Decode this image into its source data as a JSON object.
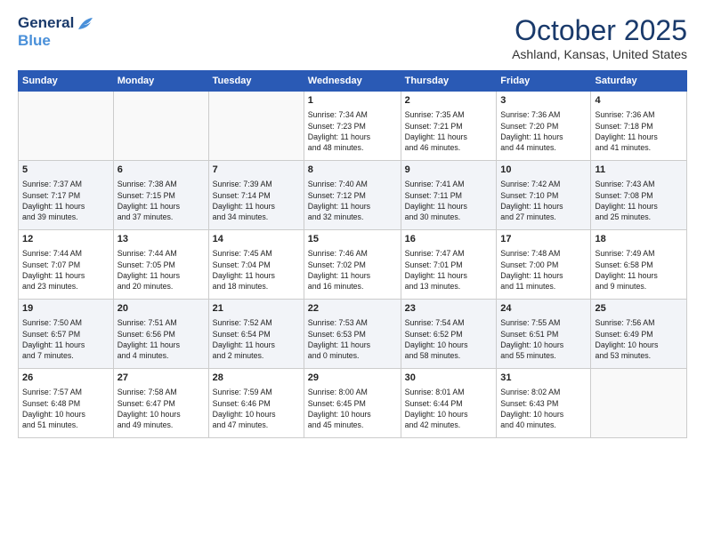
{
  "header": {
    "logo_line1": "General",
    "logo_line2": "Blue",
    "month": "October 2025",
    "location": "Ashland, Kansas, United States"
  },
  "days_of_week": [
    "Sunday",
    "Monday",
    "Tuesday",
    "Wednesday",
    "Thursday",
    "Friday",
    "Saturday"
  ],
  "weeks": [
    [
      {
        "day": "",
        "content": ""
      },
      {
        "day": "",
        "content": ""
      },
      {
        "day": "",
        "content": ""
      },
      {
        "day": "1",
        "content": "Sunrise: 7:34 AM\nSunset: 7:23 PM\nDaylight: 11 hours\nand 48 minutes."
      },
      {
        "day": "2",
        "content": "Sunrise: 7:35 AM\nSunset: 7:21 PM\nDaylight: 11 hours\nand 46 minutes."
      },
      {
        "day": "3",
        "content": "Sunrise: 7:36 AM\nSunset: 7:20 PM\nDaylight: 11 hours\nand 44 minutes."
      },
      {
        "day": "4",
        "content": "Sunrise: 7:36 AM\nSunset: 7:18 PM\nDaylight: 11 hours\nand 41 minutes."
      }
    ],
    [
      {
        "day": "5",
        "content": "Sunrise: 7:37 AM\nSunset: 7:17 PM\nDaylight: 11 hours\nand 39 minutes."
      },
      {
        "day": "6",
        "content": "Sunrise: 7:38 AM\nSunset: 7:15 PM\nDaylight: 11 hours\nand 37 minutes."
      },
      {
        "day": "7",
        "content": "Sunrise: 7:39 AM\nSunset: 7:14 PM\nDaylight: 11 hours\nand 34 minutes."
      },
      {
        "day": "8",
        "content": "Sunrise: 7:40 AM\nSunset: 7:12 PM\nDaylight: 11 hours\nand 32 minutes."
      },
      {
        "day": "9",
        "content": "Sunrise: 7:41 AM\nSunset: 7:11 PM\nDaylight: 11 hours\nand 30 minutes."
      },
      {
        "day": "10",
        "content": "Sunrise: 7:42 AM\nSunset: 7:10 PM\nDaylight: 11 hours\nand 27 minutes."
      },
      {
        "day": "11",
        "content": "Sunrise: 7:43 AM\nSunset: 7:08 PM\nDaylight: 11 hours\nand 25 minutes."
      }
    ],
    [
      {
        "day": "12",
        "content": "Sunrise: 7:44 AM\nSunset: 7:07 PM\nDaylight: 11 hours\nand 23 minutes."
      },
      {
        "day": "13",
        "content": "Sunrise: 7:44 AM\nSunset: 7:05 PM\nDaylight: 11 hours\nand 20 minutes."
      },
      {
        "day": "14",
        "content": "Sunrise: 7:45 AM\nSunset: 7:04 PM\nDaylight: 11 hours\nand 18 minutes."
      },
      {
        "day": "15",
        "content": "Sunrise: 7:46 AM\nSunset: 7:02 PM\nDaylight: 11 hours\nand 16 minutes."
      },
      {
        "day": "16",
        "content": "Sunrise: 7:47 AM\nSunset: 7:01 PM\nDaylight: 11 hours\nand 13 minutes."
      },
      {
        "day": "17",
        "content": "Sunrise: 7:48 AM\nSunset: 7:00 PM\nDaylight: 11 hours\nand 11 minutes."
      },
      {
        "day": "18",
        "content": "Sunrise: 7:49 AM\nSunset: 6:58 PM\nDaylight: 11 hours\nand 9 minutes."
      }
    ],
    [
      {
        "day": "19",
        "content": "Sunrise: 7:50 AM\nSunset: 6:57 PM\nDaylight: 11 hours\nand 7 minutes."
      },
      {
        "day": "20",
        "content": "Sunrise: 7:51 AM\nSunset: 6:56 PM\nDaylight: 11 hours\nand 4 minutes."
      },
      {
        "day": "21",
        "content": "Sunrise: 7:52 AM\nSunset: 6:54 PM\nDaylight: 11 hours\nand 2 minutes."
      },
      {
        "day": "22",
        "content": "Sunrise: 7:53 AM\nSunset: 6:53 PM\nDaylight: 11 hours\nand 0 minutes."
      },
      {
        "day": "23",
        "content": "Sunrise: 7:54 AM\nSunset: 6:52 PM\nDaylight: 10 hours\nand 58 minutes."
      },
      {
        "day": "24",
        "content": "Sunrise: 7:55 AM\nSunset: 6:51 PM\nDaylight: 10 hours\nand 55 minutes."
      },
      {
        "day": "25",
        "content": "Sunrise: 7:56 AM\nSunset: 6:49 PM\nDaylight: 10 hours\nand 53 minutes."
      }
    ],
    [
      {
        "day": "26",
        "content": "Sunrise: 7:57 AM\nSunset: 6:48 PM\nDaylight: 10 hours\nand 51 minutes."
      },
      {
        "day": "27",
        "content": "Sunrise: 7:58 AM\nSunset: 6:47 PM\nDaylight: 10 hours\nand 49 minutes."
      },
      {
        "day": "28",
        "content": "Sunrise: 7:59 AM\nSunset: 6:46 PM\nDaylight: 10 hours\nand 47 minutes."
      },
      {
        "day": "29",
        "content": "Sunrise: 8:00 AM\nSunset: 6:45 PM\nDaylight: 10 hours\nand 45 minutes."
      },
      {
        "day": "30",
        "content": "Sunrise: 8:01 AM\nSunset: 6:44 PM\nDaylight: 10 hours\nand 42 minutes."
      },
      {
        "day": "31",
        "content": "Sunrise: 8:02 AM\nSunset: 6:43 PM\nDaylight: 10 hours\nand 40 minutes."
      },
      {
        "day": "",
        "content": ""
      }
    ]
  ]
}
